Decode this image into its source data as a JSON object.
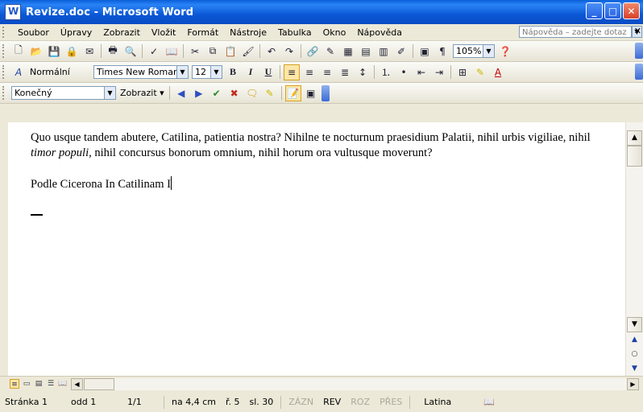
{
  "window": {
    "title": "Revize.doc - Microsoft Word"
  },
  "menu": {
    "items": [
      "Soubor",
      "Úpravy",
      "Zobrazit",
      "Vložit",
      "Formát",
      "Nástroje",
      "Tabulka",
      "Okno",
      "Nápověda"
    ],
    "help_placeholder": "Nápověda – zadejte dotaz"
  },
  "standard_toolbar": {
    "zoom": "105%"
  },
  "format_toolbar": {
    "style": "Normální",
    "font": "Times New Roman",
    "size": "12",
    "bold": "B",
    "italic": "I",
    "underline": "U"
  },
  "review_toolbar": {
    "display_for_review": "Konečný",
    "show_label": "Zobrazit"
  },
  "document": {
    "p1_a": "Quo usque tandem abutere, Catilina, patientia nostra? Nihilne te nocturnum praesidium Palatii, nihil urbis vigiliae, nihil ",
    "p1_italic": "timor populi",
    "p1_b": ", nihil concursus bonorum omnium, nihil horum ora vultusque moverunt?",
    "p2": "Podle Cicerona In Catilinam I"
  },
  "status": {
    "page": "Stránka 1",
    "section": "odd 1",
    "pages": "1/1",
    "position": "na 4,4 cm",
    "line": "ř. 5",
    "column": "sl. 30",
    "rec": "ZÁZN",
    "rev": "REV",
    "ext": "ROZ",
    "ovr": "PŘES",
    "language": "Latina"
  }
}
